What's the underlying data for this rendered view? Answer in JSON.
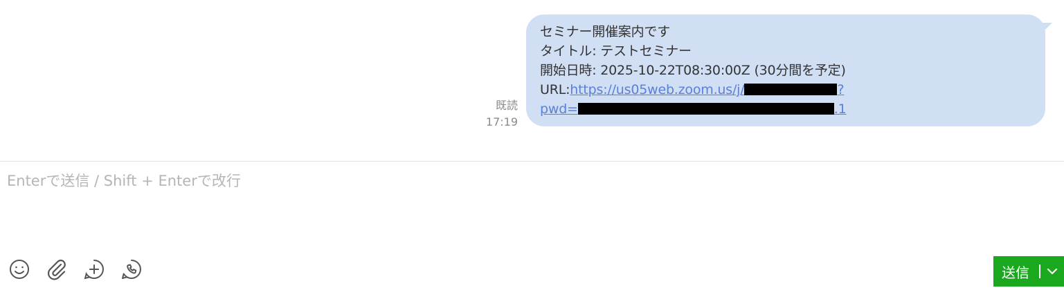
{
  "message": {
    "status": "既読",
    "time": "17:19",
    "lines": [
      "セミナー開催案内です",
      "タイトル: テストセミナー",
      "開始日時: 2025-10-22T08:30:00Z (30分間を予定)"
    ],
    "url_label": "URL:",
    "url_text": "https://us05web.zoom.us/j/",
    "url_text_end": "?",
    "pwd_text": "pwd=",
    "pwd_text_end": ".1"
  },
  "composer": {
    "placeholder": "Enterで送信 / Shift + Enterで改行"
  },
  "toolbar": {
    "icons": [
      "emoji-icon",
      "attachment-icon",
      "add-circle-icon",
      "phone-call-icon"
    ]
  },
  "send": {
    "label": "送信",
    "color": "#1aa91e"
  },
  "colors": {
    "bubble": "#d1dff5",
    "link": "#5a7fd6"
  }
}
